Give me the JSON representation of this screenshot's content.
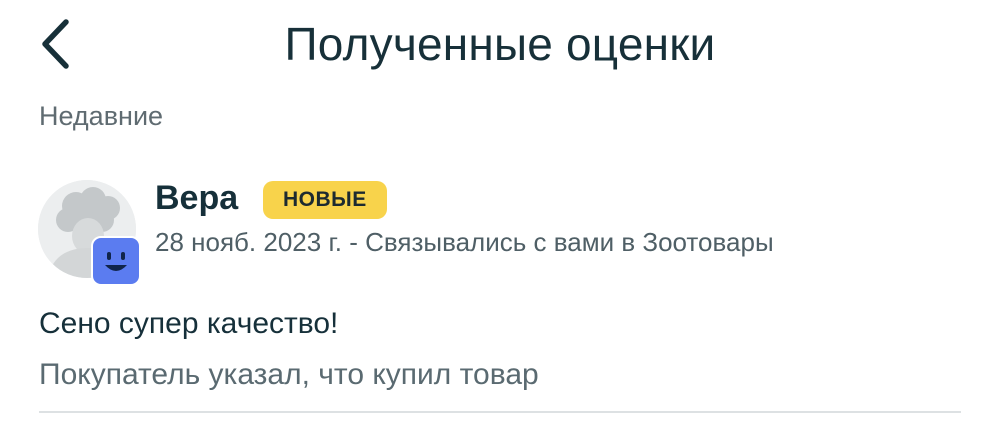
{
  "header": {
    "title": "Полученные оценки",
    "back_icon": "chevron-left-icon"
  },
  "section": {
    "label": "Недавние"
  },
  "review": {
    "reviewer_name": "Вера",
    "badge_label": "НОВЫЕ",
    "meta": "28 нояб. 2023 г. - Связывались с вами в Зоотовары",
    "text": "Сено супер качество!",
    "note": "Покупатель указал, что купил товар",
    "avatar_icon": "user-avatar-icon",
    "avatar_badge_icon": "smiley-badge-icon"
  },
  "colors": {
    "badge_bg": "#f8d34b",
    "avatar_badge": "#5b7cf0",
    "text_primary": "#16303a",
    "text_secondary": "#5a6a71"
  }
}
